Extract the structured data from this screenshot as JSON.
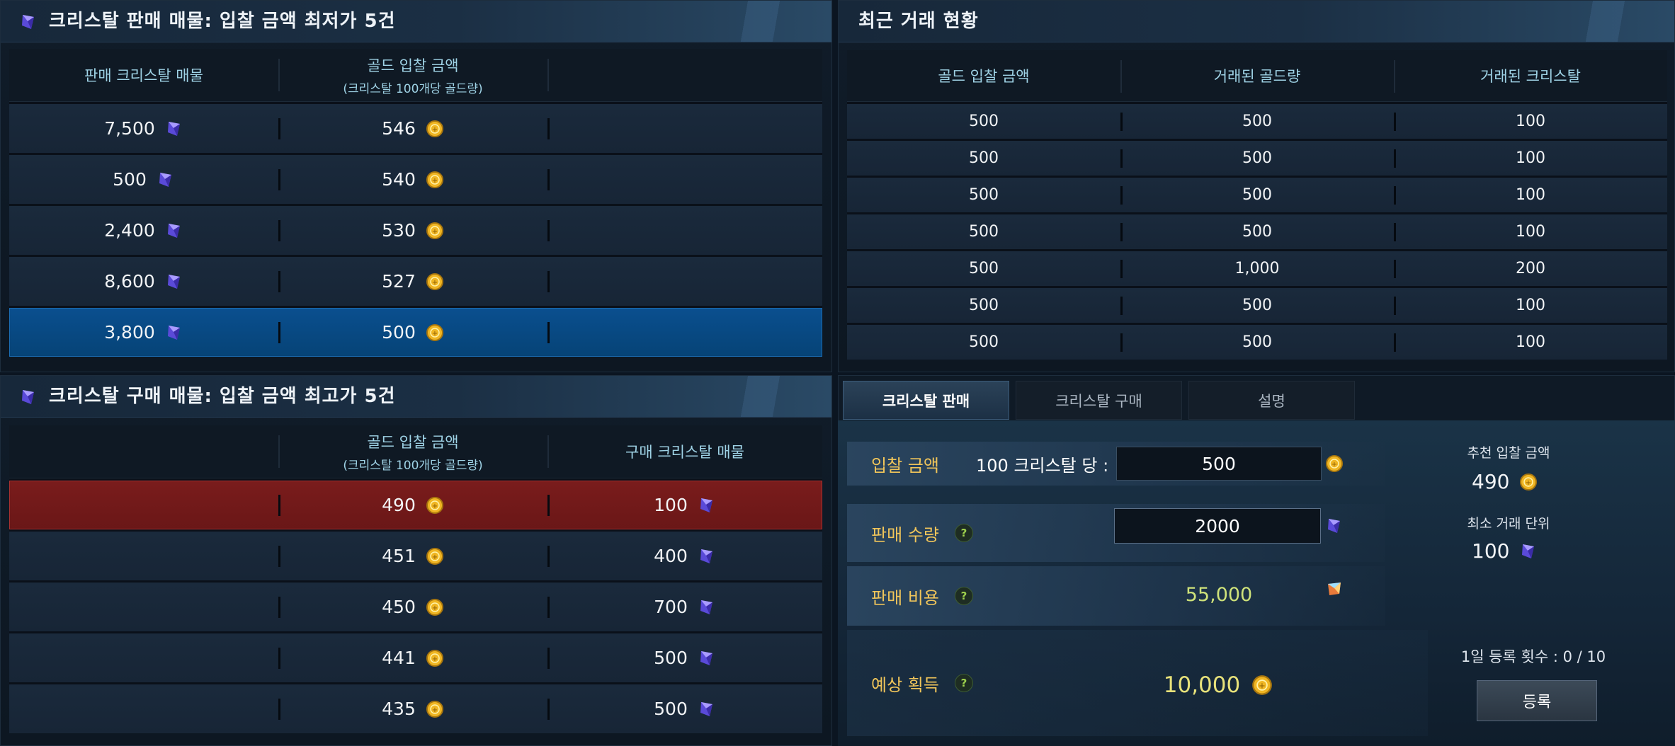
{
  "colors": {
    "accent_gold": "#f0c55a",
    "selected_sell_row": "#064376",
    "selected_buy_row": "#6a1717",
    "header_text": "#9fd3e6"
  },
  "icons": {
    "crystal": "crystal-icon",
    "gold": "gold-coin-icon",
    "royal_crystal": "royal-crystal-icon"
  },
  "sell_panel": {
    "title": "크리스탈 판매 매물: 입찰 금액 최저가 5건",
    "col1": "판매 크리스탈 매물",
    "col2": "골드 입찰 금액",
    "col2_sub": "(크리스탈 100개당 골드량)",
    "rows": [
      {
        "crystal": "7,500",
        "gold": "546"
      },
      {
        "crystal": "500",
        "gold": "540"
      },
      {
        "crystal": "2,400",
        "gold": "530"
      },
      {
        "crystal": "8,600",
        "gold": "527"
      },
      {
        "crystal": "3,800",
        "gold": "500"
      }
    ]
  },
  "buy_panel": {
    "title": "크리스탈 구매 매물: 입찰 금액 최고가 5건",
    "col2": "골드 입찰 금액",
    "col2_sub": "(크리스탈 100개당 골드량)",
    "col3": "구매 크리스탈 매물",
    "rows": [
      {
        "gold": "490",
        "crystal": "100"
      },
      {
        "gold": "451",
        "crystal": "400"
      },
      {
        "gold": "450",
        "crystal": "700"
      },
      {
        "gold": "441",
        "crystal": "500"
      },
      {
        "gold": "435",
        "crystal": "500"
      }
    ]
  },
  "recent_panel": {
    "title": "최근 거래 현황",
    "col1": "골드 입찰 금액",
    "col2": "거래된 골드량",
    "col3": "거래된 크리스탈",
    "rows": [
      {
        "bid": "500",
        "gold": "500",
        "crystal": "100"
      },
      {
        "bid": "500",
        "gold": "500",
        "crystal": "100"
      },
      {
        "bid": "500",
        "gold": "500",
        "crystal": "100"
      },
      {
        "bid": "500",
        "gold": "500",
        "crystal": "100"
      },
      {
        "bid": "500",
        "gold": "1,000",
        "crystal": "200"
      },
      {
        "bid": "500",
        "gold": "500",
        "crystal": "100"
      },
      {
        "bid": "500",
        "gold": "500",
        "crystal": "100"
      }
    ]
  },
  "tabs": [
    {
      "label": "크리스탈 판매",
      "active": true
    },
    {
      "label": "크리스탈 구매",
      "active": false
    },
    {
      "label": "설명",
      "active": false
    }
  ],
  "form": {
    "bid_label": "입찰 금액",
    "per_label": "100 크리스탈 당 :",
    "bid_value": "500",
    "qty_label": "판매 수량",
    "qty_value": "2000",
    "fee_label": "판매 비용",
    "fee_value": "55,000",
    "expected_label": "예상 획득",
    "expected_value": "10,000",
    "help": "?",
    "recommended_label": "추천 입찰 금액",
    "recommended_value": "490",
    "min_unit_label": "최소 거래 단위",
    "min_unit_value": "100",
    "daily_count": "1일 등록 횟수 : 0 / 10",
    "register_label": "등록"
  }
}
